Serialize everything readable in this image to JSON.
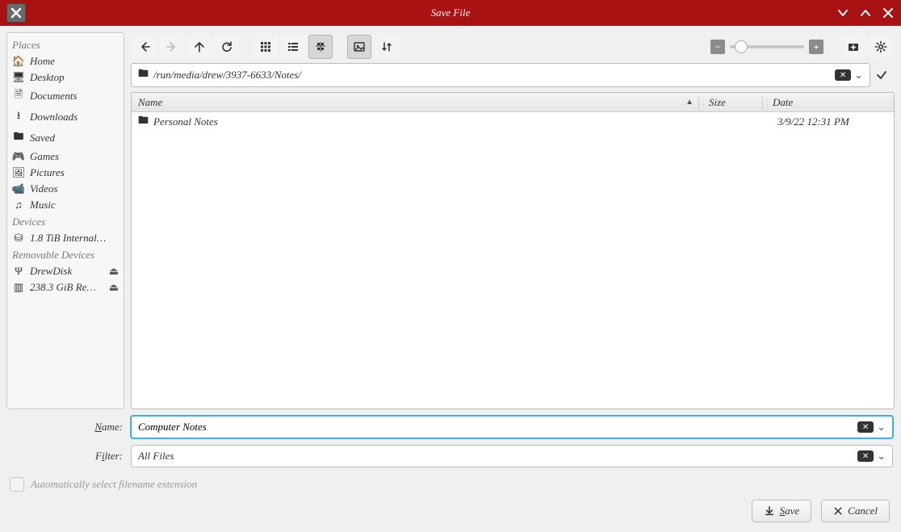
{
  "window": {
    "title": "Save File"
  },
  "sidebar": {
    "places_label": "Places",
    "devices_label": "Devices",
    "removable_label": "Removable Devices",
    "places": [
      {
        "icon": "home",
        "label": "Home"
      },
      {
        "icon": "desktop",
        "label": "Desktop"
      },
      {
        "icon": "document",
        "label": "Documents"
      },
      {
        "icon": "download",
        "label": "Downloads"
      },
      {
        "icon": "folder",
        "label": "Saved"
      },
      {
        "icon": "games",
        "label": "Games"
      },
      {
        "icon": "pictures",
        "label": "Pictures"
      },
      {
        "icon": "videos",
        "label": "Videos"
      },
      {
        "icon": "music",
        "label": "Music"
      }
    ],
    "devices": [
      {
        "icon": "disk",
        "label": "1.8 TiB Internal…"
      }
    ],
    "removable": [
      {
        "icon": "usb",
        "label": "DrewDisk"
      },
      {
        "icon": "sd",
        "label": "238.3 GiB Re…"
      }
    ]
  },
  "path": "/run/media/drew/3937-6633/Notes/",
  "columns": {
    "name": "Name",
    "size": "Size",
    "date": "Date"
  },
  "files": [
    {
      "name": "Personal Notes",
      "size": "",
      "date": "3/9/22 12:31 PM",
      "type": "folder"
    }
  ],
  "form": {
    "name_label_pre": "N",
    "name_label_post": "ame:",
    "filter_label_pre": "F",
    "filter_label_mid": "i",
    "filter_label_post": "lter:",
    "name_value": "Computer Notes",
    "filter_value": "All Files",
    "auto_ext": "Automatically select filename extension"
  },
  "buttons": {
    "save_pre": "S",
    "save_post": "ave",
    "cancel": "Cancel"
  }
}
